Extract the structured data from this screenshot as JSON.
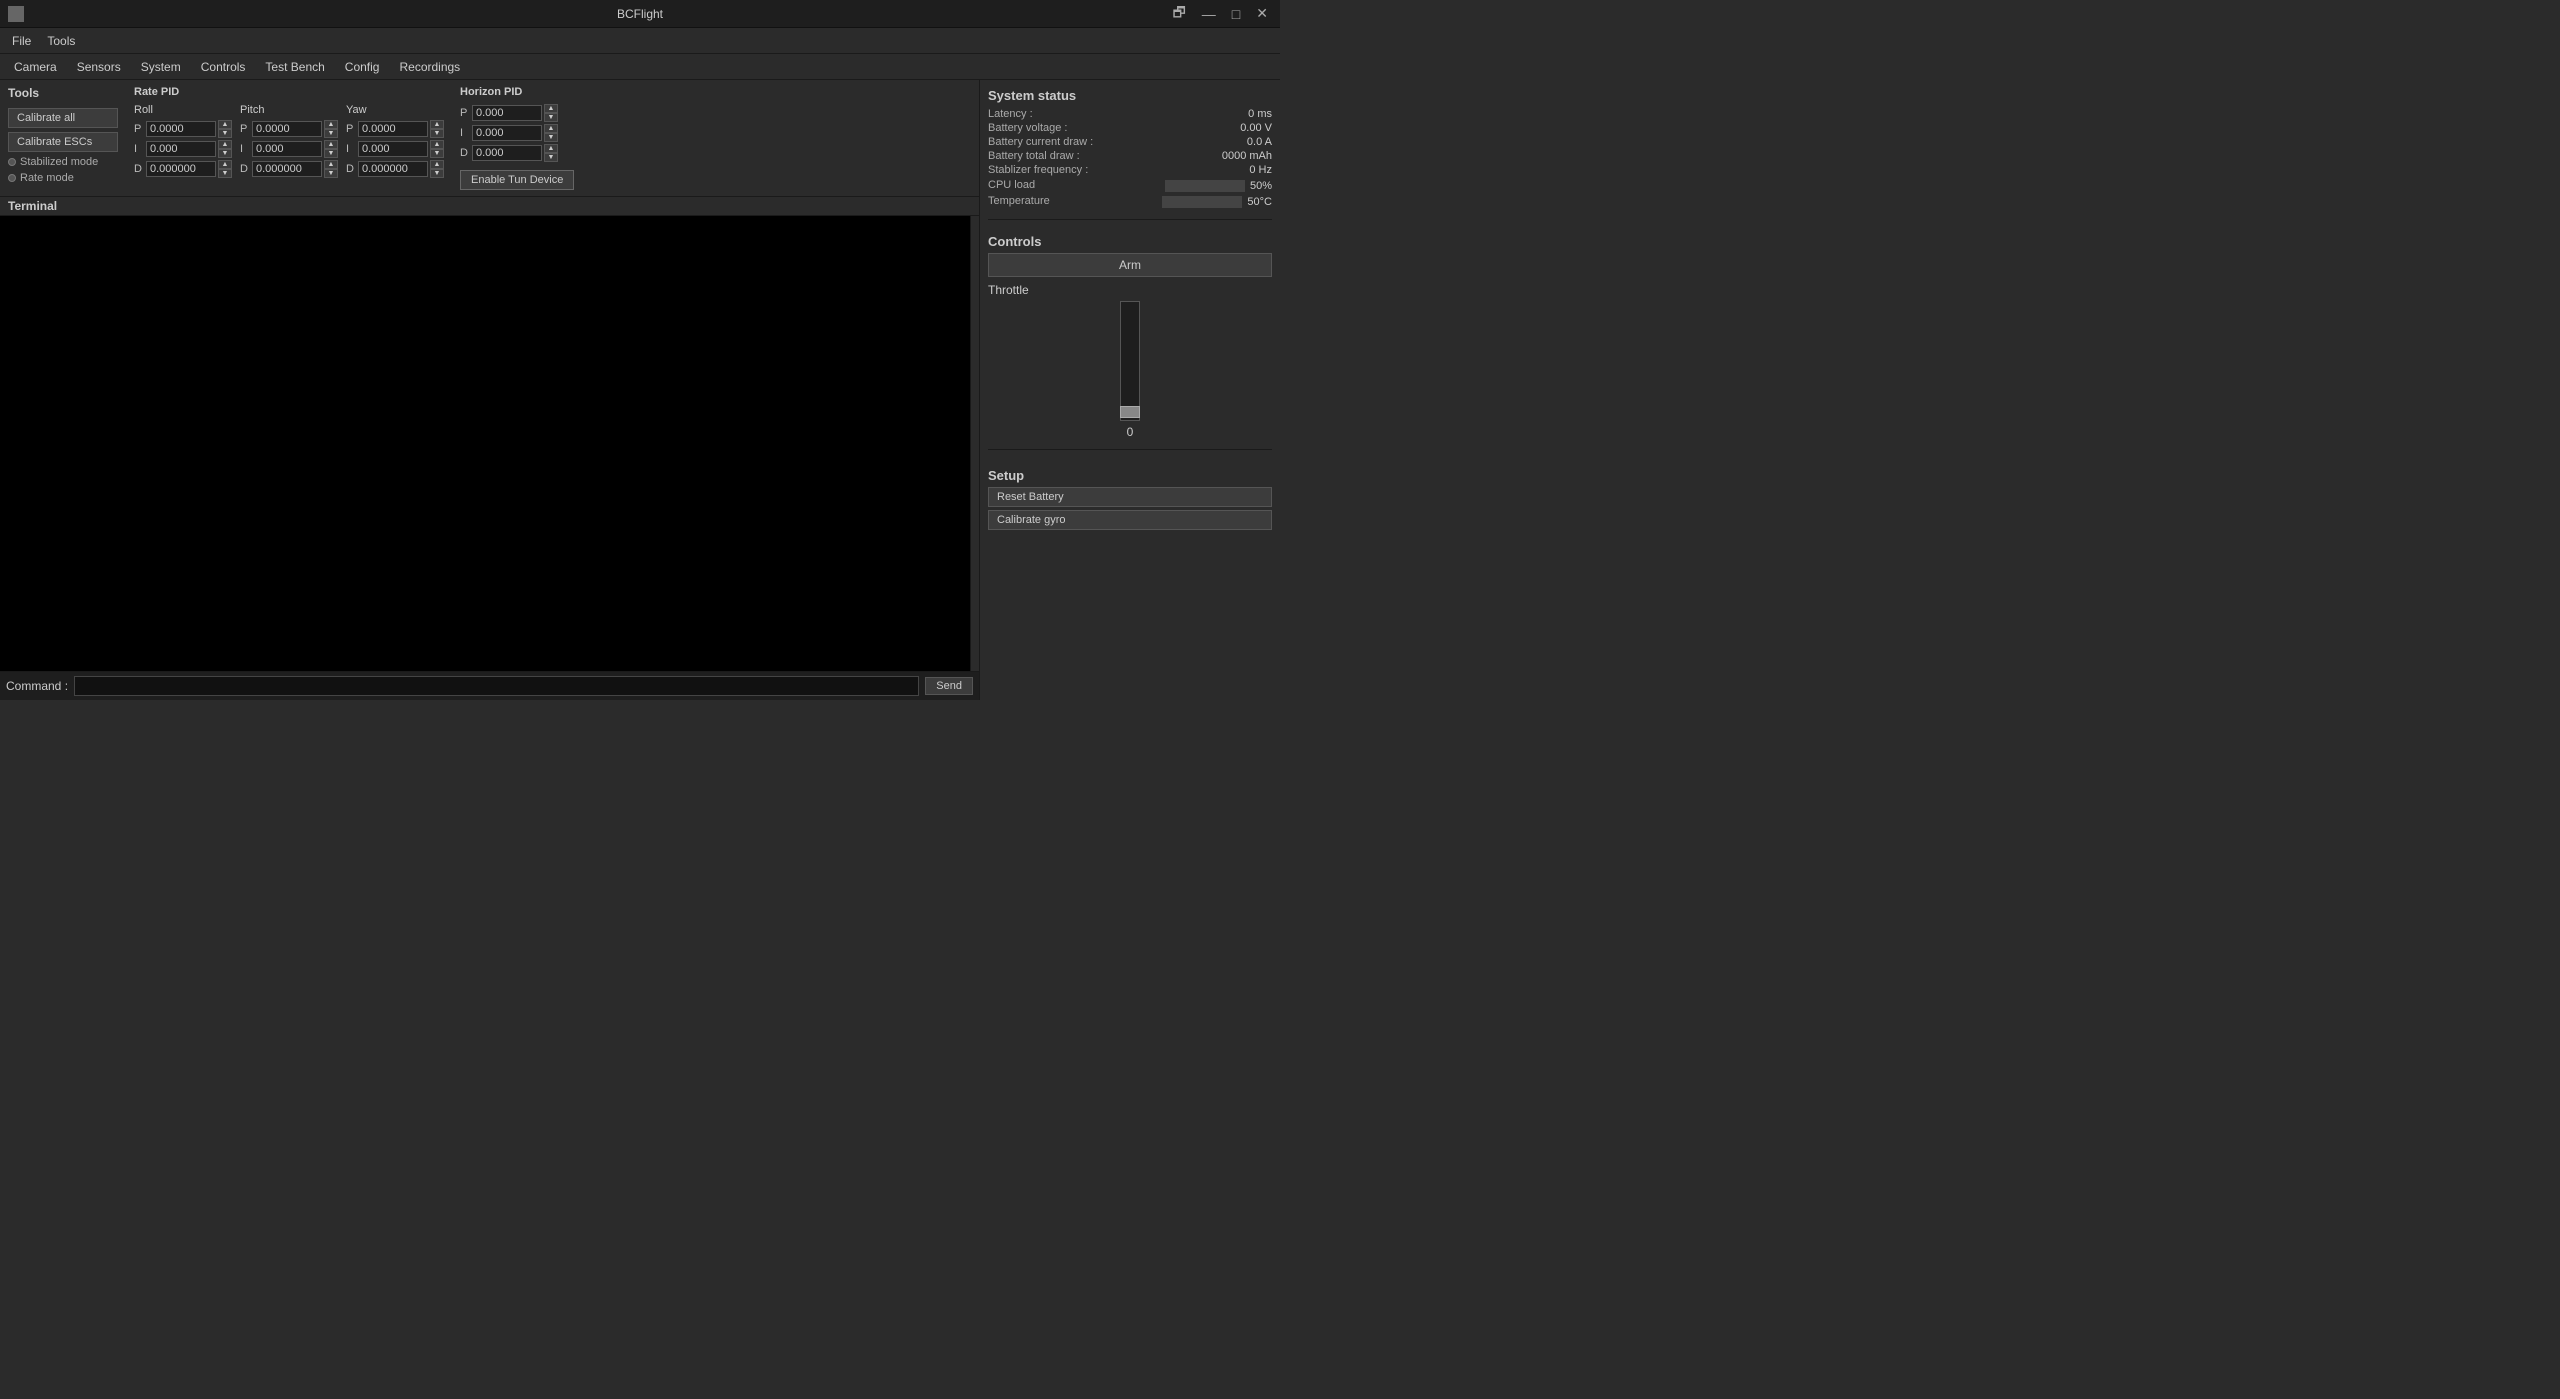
{
  "app": {
    "title": "BCFlight",
    "logo": "■"
  },
  "titlebar": {
    "restore": "🗗",
    "minimize": "—",
    "maximize": "□",
    "close": "✕"
  },
  "menubar": {
    "items": [
      "File",
      "Tools"
    ]
  },
  "tabbar": {
    "items": [
      "Camera",
      "Sensors",
      "System",
      "Controls",
      "Test Bench",
      "Config",
      "Recordings"
    ]
  },
  "tools": {
    "section_label": "Tools",
    "calibrate_all": "Calibrate all",
    "calibrate_escs": "Calibrate ESCs",
    "stabilized_mode": "Stabilized mode",
    "rate_mode": "Rate mode"
  },
  "rate_pid": {
    "title": "Rate PID",
    "roll_label": "Roll",
    "pitch_label": "Pitch",
    "yaw_label": "Yaw",
    "roll": {
      "p_label": "P",
      "p_val": "0.0000",
      "i_label": "I",
      "i_val": "0.000",
      "d_label": "D",
      "d_val": "0.000000"
    },
    "pitch": {
      "p_label": "P",
      "p_val": "0.0000",
      "i_label": "I",
      "i_val": "0.000",
      "d_label": "D",
      "d_val": "0.000000"
    },
    "yaw": {
      "p_label": "P",
      "p_val": "0.0000",
      "i_label": "I",
      "i_val": "0.000",
      "d_label": "D",
      "d_val": "0.000000"
    }
  },
  "horizon_pid": {
    "title": "Horizon PID",
    "p_label": "P",
    "p_val": "0.000",
    "i_label": "I",
    "i_val": "0.000",
    "d_label": "D",
    "d_val": "0.000",
    "enable_btn": "Enable Tun Device"
  },
  "terminal": {
    "label": "Terminal",
    "content": ""
  },
  "command_bar": {
    "label": "Command :",
    "placeholder": "",
    "send_label": "Send"
  },
  "system_status": {
    "title": "System status",
    "latency_key": "Latency :",
    "latency_val": "0 ms",
    "battery_voltage_key": "Battery voltage :",
    "battery_voltage_val": "0.00 V",
    "battery_current_key": "Battery current draw :",
    "battery_current_val": "0.0 A",
    "battery_total_key": "Battery total draw :",
    "battery_total_val": "0000 mAh",
    "stabilizer_freq_key": "Stablizer frequency :",
    "stabilizer_freq_val": "0 Hz",
    "cpu_load_key": "CPU load",
    "cpu_load_val": "50%",
    "cpu_load_pct": 50,
    "temperature_key": "Temperature",
    "temperature_val": "50°C",
    "temperature_pct": 50
  },
  "controls": {
    "title": "Controls",
    "arm_label": "Arm",
    "throttle_label": "Throttle",
    "throttle_value": "0"
  },
  "setup": {
    "title": "Setup",
    "reset_battery": "Reset Battery",
    "calibrate_gyro": "Calibrate gyro"
  },
  "icons": {
    "up_arrow": "▲",
    "down_arrow": "▼"
  }
}
